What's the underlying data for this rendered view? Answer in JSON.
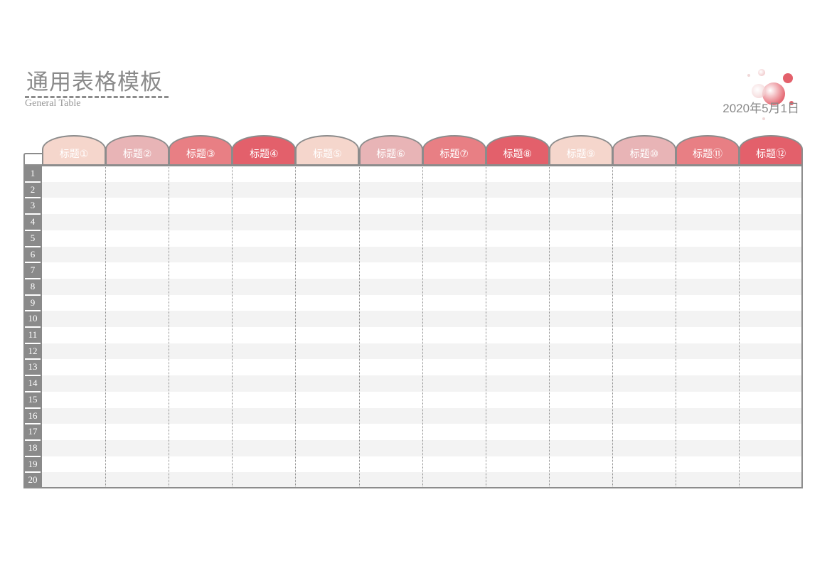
{
  "header": {
    "title": "通用表格模板",
    "subtitle": "General Table",
    "date": "2020年5月1日"
  },
  "columns": [
    {
      "label": "标题①",
      "color": "#f5d6cc"
    },
    {
      "label": "标题②",
      "color": "#e8b4b6"
    },
    {
      "label": "标题③",
      "color": "#e87f84"
    },
    {
      "label": "标题④",
      "color": "#e3606b"
    },
    {
      "label": "标题⑤",
      "color": "#f5d6cc"
    },
    {
      "label": "标题⑥",
      "color": "#e8b4b6"
    },
    {
      "label": "标题⑦",
      "color": "#e87f84"
    },
    {
      "label": "标题⑧",
      "color": "#e3606b"
    },
    {
      "label": "标题⑨",
      "color": "#f5d6cc"
    },
    {
      "label": "标题⑩",
      "color": "#e8b4b6"
    },
    {
      "label": "标题⑪",
      "color": "#e87f84"
    },
    {
      "label": "标题⑫",
      "color": "#e3606b"
    }
  ],
  "rows": [
    "1",
    "2",
    "3",
    "4",
    "5",
    "6",
    "7",
    "8",
    "9",
    "10",
    "11",
    "12",
    "13",
    "14",
    "15",
    "16",
    "17",
    "18",
    "19",
    "20"
  ],
  "colors": {
    "border": "#8c8c8c",
    "row_alt": "#f3f3f3",
    "text_gray": "#8a8a8a",
    "accent": "#e3606b"
  }
}
